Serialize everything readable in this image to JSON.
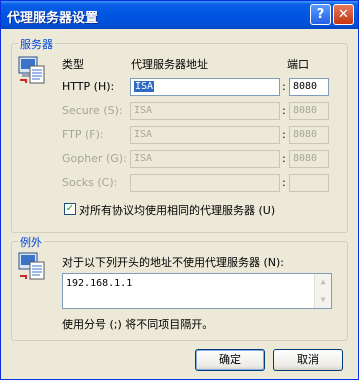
{
  "window": {
    "title": "代理服务器设置",
    "help_button": "?",
    "close_button": "✕"
  },
  "servers": {
    "group_title": "服务器",
    "col_type": "类型",
    "col_address": "代理服务器地址",
    "col_port": "端口",
    "rows": [
      {
        "label": "HTTP (H):",
        "address": "ISA",
        "port": "8080",
        "enabled": true
      },
      {
        "label": "Secure (S):",
        "address": "ISA",
        "port": "8080",
        "enabled": false
      },
      {
        "label": "FTP (F):",
        "address": "ISA",
        "port": "8080",
        "enabled": false
      },
      {
        "label": "Gopher (G):",
        "address": "ISA",
        "port": "8080",
        "enabled": false
      },
      {
        "label": "Socks (C):",
        "address": "",
        "port": "",
        "enabled": false
      }
    ],
    "colon": ":",
    "same_proxy_label": "对所有协议均使用相同的代理服务器 (U)",
    "same_proxy_checked": true
  },
  "exceptions": {
    "group_title": "例外",
    "description": "对于以下列开头的地址不使用代理服务器 (N):",
    "value": "192.168.1.1",
    "hint": "使用分号 (;) 将不同项目隔开。"
  },
  "buttons": {
    "ok": "确定",
    "cancel": "取消"
  }
}
